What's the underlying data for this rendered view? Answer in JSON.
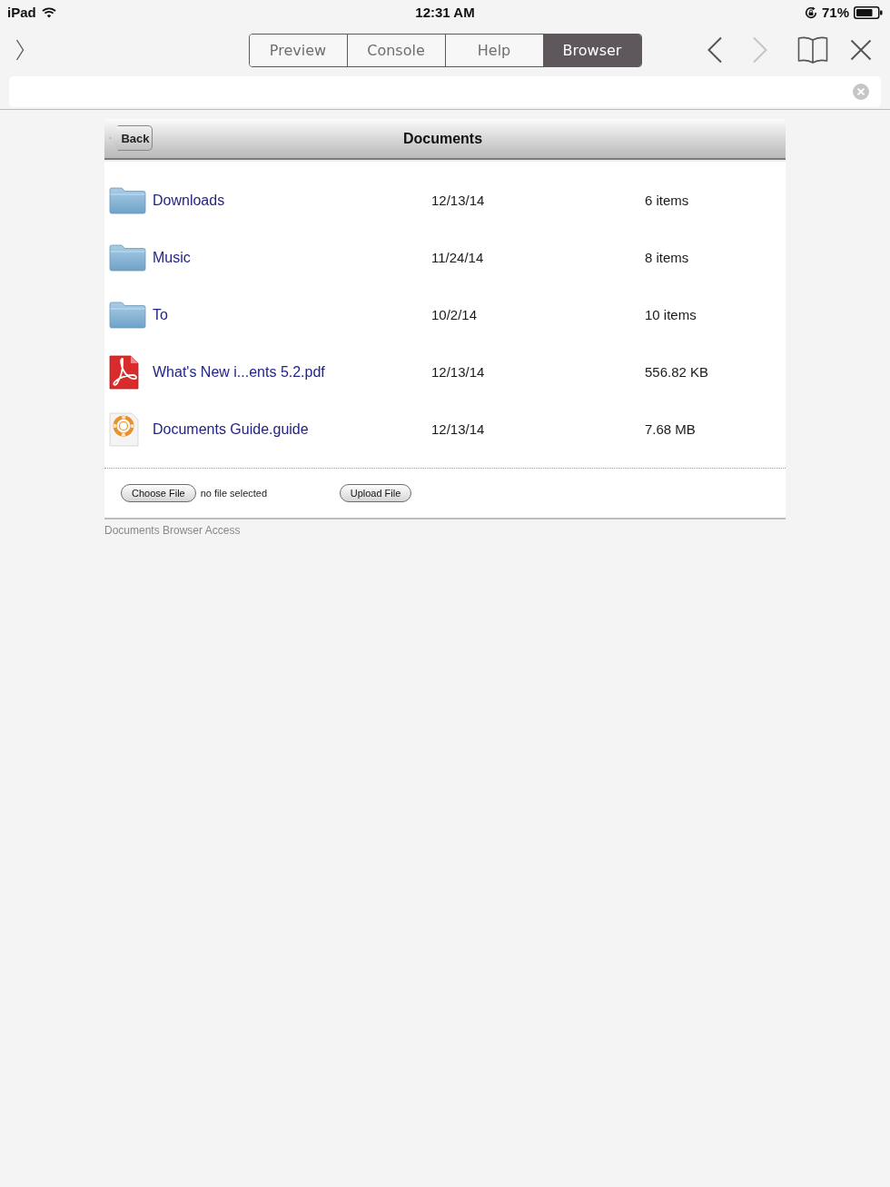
{
  "status_bar": {
    "device": "iPad",
    "time": "12:31 AM",
    "battery": "71%"
  },
  "toolbar": {
    "tabs": [
      {
        "label": "Preview",
        "selected": false
      },
      {
        "label": "Console",
        "selected": false
      },
      {
        "label": "Help",
        "selected": false
      },
      {
        "label": "Browser",
        "selected": true
      }
    ],
    "nav_buttons": [
      {
        "kind": "back",
        "disabled": false
      },
      {
        "kind": "forward",
        "disabled": true
      }
    ]
  },
  "panel": {
    "back_button": "Back",
    "title": "Documents",
    "files": [
      {
        "kind": "folder",
        "name": "Downloads",
        "date": "12/13/14",
        "size": "6 items"
      },
      {
        "kind": "folder",
        "name": "Music",
        "date": "11/24/14",
        "size": "8 items"
      },
      {
        "kind": "folder",
        "name": "To",
        "date": "10/2/14",
        "size": "10 items"
      },
      {
        "kind": "pdf",
        "name": "What's New i...ents 5.2.pdf",
        "date": "12/13/14",
        "size": "556.82 KB"
      },
      {
        "kind": "guide",
        "name": "Documents Guide.guide",
        "date": "12/13/14",
        "size": "7.68 MB"
      }
    ],
    "upload": {
      "choose_button": "Choose File",
      "file_status": "no file selected",
      "upload_button": "Upload File"
    }
  },
  "footer": "Documents Browser Access"
}
